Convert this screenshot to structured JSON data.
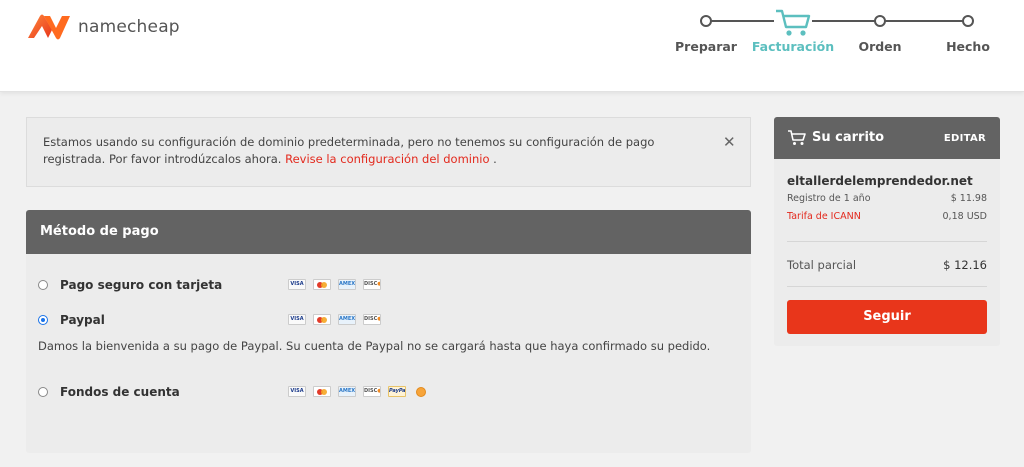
{
  "brand": {
    "name": "namecheap",
    "color": "#ff5a1f"
  },
  "progress": {
    "steps": [
      {
        "label": "Preparar",
        "state": "done"
      },
      {
        "label": "Facturación",
        "state": "active"
      },
      {
        "label": "Orden",
        "state": "pending"
      },
      {
        "label": "Hecho",
        "state": "pending"
      }
    ],
    "active_color": "#5cbfbf"
  },
  "alert": {
    "message": "Estamos usando su configuración de dominio predeterminada, pero no tenemos su configuración de pago registrada. Por favor introdúzcalos ahora.",
    "link_text": "Revise la configuración del dominio",
    "suffix": " .",
    "close_icon": "close-icon"
  },
  "payment": {
    "title": "Método de pago",
    "options": [
      {
        "label": "Pago seguro con tarjeta",
        "selected": false
      },
      {
        "label": "Paypal",
        "selected": true
      },
      {
        "label": "Fondos de cuenta",
        "selected": false
      }
    ],
    "paypal_note": "Damos la bienvenida a su pago de Paypal. Su cuenta de Paypal no se cargará hasta que haya confirmado su pedido.",
    "card_icons": [
      "visa-icon",
      "mastercard-icon",
      "amex-icon",
      "discover-icon"
    ],
    "funds_icons": [
      "visa-icon",
      "mastercard-icon",
      "amex-icon",
      "discover-icon",
      "paypal-icon",
      "bitcoin-icon"
    ]
  },
  "cart": {
    "title": "Su carrito",
    "edit_label": "EDITAR",
    "domain": "eltallerdelemprendedor.net",
    "lines": [
      {
        "label": "Registro de 1 año",
        "amount": "$ 11.98",
        "highlight": false
      },
      {
        "label": "Tarifa de ICANN",
        "amount": "0,18 USD",
        "highlight": true
      }
    ],
    "subtotal_label": "Total parcial",
    "subtotal_amount": "$ 12.16",
    "continue_label": "Seguir",
    "button_color": "#e8361b"
  }
}
